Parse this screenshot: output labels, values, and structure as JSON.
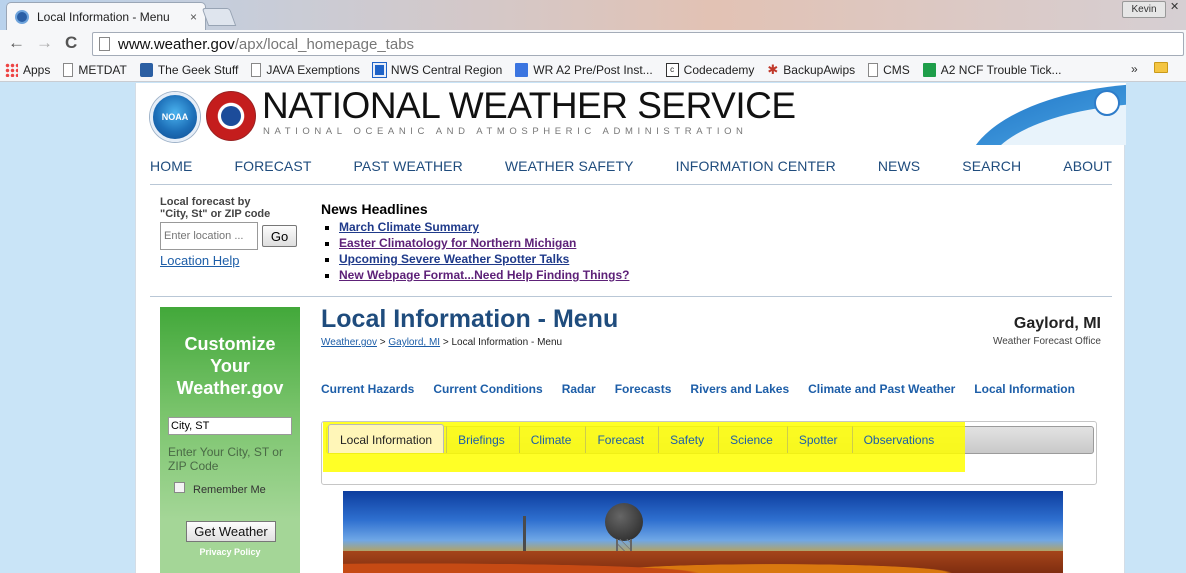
{
  "browser": {
    "tab_title": "Local Information - Menu",
    "tab_close": "×",
    "profile_name": "Kevin",
    "url_host": "www.weather.gov",
    "url_path": "/apx/local_homepage_tabs",
    "back_glyph": "←",
    "forward_glyph": "→",
    "reload_glyph": "C",
    "bookmarks": [
      {
        "label": "Apps",
        "icon": "apps-grid-icon"
      },
      {
        "label": "METDAT",
        "icon": "page-icon"
      },
      {
        "label": "The Geek Stuff",
        "icon": "geek-stuff-icon"
      },
      {
        "label": "JAVA Exemptions",
        "icon": "page-icon"
      },
      {
        "label": "NWS Central Region",
        "icon": "nws-icon"
      },
      {
        "label": "WR A2 Pre/Post Inst...",
        "icon": "doc-icon"
      },
      {
        "label": "Codecademy",
        "icon": "codecademy-icon"
      },
      {
        "label": "BackupAwips",
        "icon": "paw-icon"
      },
      {
        "label": "CMS",
        "icon": "page-icon"
      },
      {
        "label": "A2 NCF Trouble Tick...",
        "icon": "sheet-icon"
      }
    ],
    "bookmarks_more": "»"
  },
  "header": {
    "noaa_text": "NOAA",
    "title": "NATIONAL WEATHER SERVICE",
    "subtitle": "NATIONAL OCEANIC AND ATMOSPHERIC ADMINISTRATION"
  },
  "mainnav": [
    "HOME",
    "FORECAST",
    "PAST WEATHER",
    "WEATHER SAFETY",
    "INFORMATION CENTER",
    "NEWS",
    "SEARCH",
    "ABOUT"
  ],
  "location": {
    "label_line1": "Local forecast by",
    "label_line2": "\"City, St\" or ZIP code",
    "placeholder": "Enter location ...",
    "go_label": "Go",
    "help_label": "Location Help"
  },
  "news": {
    "heading": "News Headlines",
    "items": [
      "March Climate Summary",
      "Easter Climatology for Northern Michigan",
      "Upcoming Severe Weather Spotter Talks",
      "New Webpage Format...Need Help Finding Things?"
    ]
  },
  "sidebar": {
    "title_line1": "Customize",
    "title_line2": "Your",
    "title_line3": "Weather.gov",
    "input_value": "City, ST",
    "hint": "Enter Your City, ST or ZIP Code",
    "remember_label": "Remember Me",
    "button_label": "Get Weather",
    "privacy_label": "Privacy Policy"
  },
  "content": {
    "title": "Local Information - Menu",
    "breadcrumb": {
      "item1": "Weather.gov",
      "sep1": " > ",
      "item2": "Gaylord, MI",
      "sep2": " > ",
      "current": "Local Information - Menu"
    },
    "office_name": "Gaylord, MI",
    "office_sub": "Weather Forecast Office",
    "subnav": [
      "Current Hazards",
      "Current Conditions",
      "Radar",
      "Forecasts",
      "Rivers and Lakes",
      "Climate and Past Weather",
      "Local Information"
    ],
    "tabs": [
      "Local Information",
      "Briefings",
      "Climate",
      "Forecast",
      "Safety",
      "Science",
      "Spotter",
      "Observations"
    ],
    "highlight_color": "#ffff00"
  }
}
